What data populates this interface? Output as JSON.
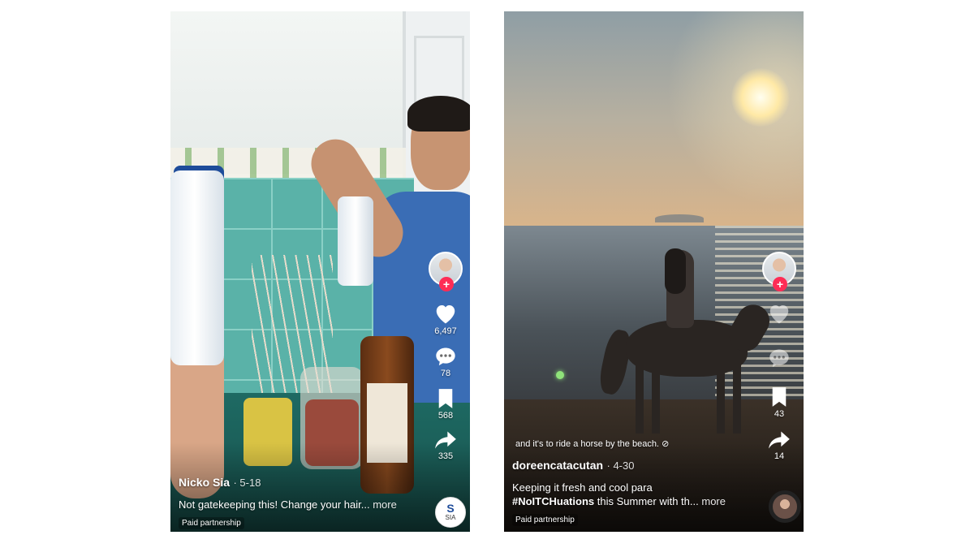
{
  "posts": [
    {
      "username": "Nicko Sia",
      "date": "· 5-18",
      "caption": "Not gatekeeping this! Change your hair...",
      "more": "more",
      "paid_partnership": "Paid partnership",
      "likes": "6,497",
      "comments": "78",
      "saves": "568",
      "shares": "335",
      "sound_label": "SIA"
    },
    {
      "subtitle": "and it's to ride a horse by the beach.",
      "username": "doreencatacutan",
      "date": "· 4-30",
      "caption_line1": "Keeping it fresh and cool para",
      "hashtag": "#NoITCHuations",
      "caption_line2": "this Summer with th...",
      "more": "more",
      "paid_partnership": "Paid partnership",
      "saves": "43",
      "shares": "14"
    }
  ],
  "colors": {
    "follow_accent": "#fe2c55",
    "overlay_text": "#ffffff"
  },
  "icons": [
    "heart-icon",
    "comment-icon",
    "bookmark-icon",
    "share-icon",
    "follow-plus-icon"
  ]
}
